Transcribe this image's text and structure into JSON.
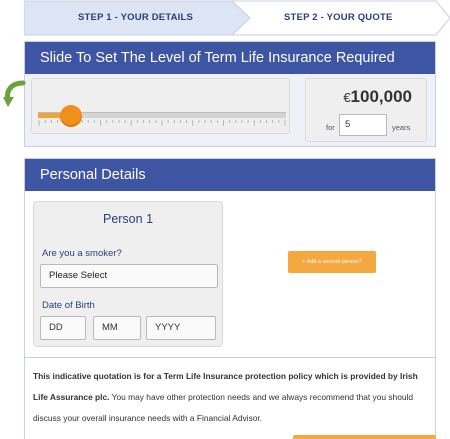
{
  "steps": {
    "step1": "STEP 1 - YOUR DETAILS",
    "step2": "STEP 2 - YOUR QUOTE"
  },
  "slider_panel": {
    "title": "Slide To Set The Level of Term Life Insurance Required",
    "currency_symbol": "€",
    "amount": "100,000",
    "for_label": "for",
    "years_value": "5",
    "years_label": "years",
    "slider_level": 0.1
  },
  "personal_panel": {
    "title": "Personal Details",
    "person_title": "Person 1",
    "smoker_label": "Are you a smoker?",
    "smoker_value": "Please Select",
    "dob_label": "Date of Birth",
    "dob_dd": "DD",
    "dob_mm": "MM",
    "dob_yyyy": "YYYY",
    "add_person_label": "+ Add a second person?"
  },
  "disclaimer": {
    "lead": "This indicative quotation is for a Term Life Insurance protection policy which is provided by Irish Life Assurance plc.",
    "rest": " You may have other protection needs and we always recommend that you should discuss your overall insurance needs with a Financial Advisor."
  },
  "colors": {
    "header_blue": "#3e55a3",
    "accent_orange": "#f4a83f",
    "knob_orange": "#ef8f1c",
    "arrow_green": "#6aa33b"
  }
}
